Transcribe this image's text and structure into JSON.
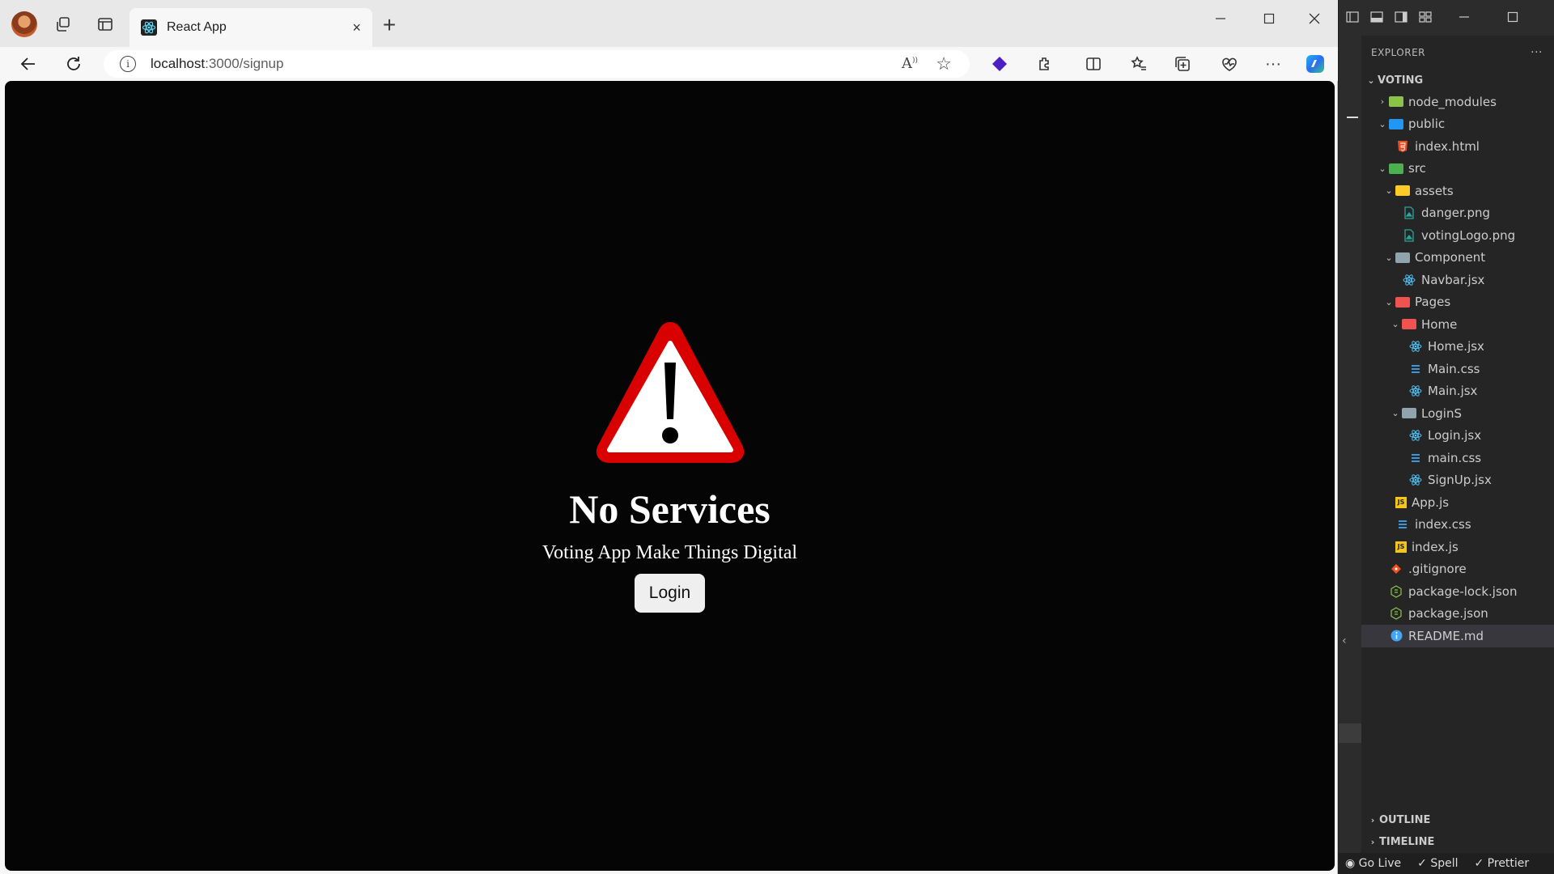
{
  "browser": {
    "tab_title": "React App",
    "new_tab_label": "+",
    "close_tab_label": "×",
    "url_host": "localhost",
    "url_path": ":3000/signup"
  },
  "page": {
    "heading": "No Services",
    "tagline": "Voting App Make Things Digital",
    "login_label": "Login",
    "colors": {
      "background": "#050505",
      "warning_red": "#d90000",
      "text": "#ffffff"
    }
  },
  "vscode": {
    "explorer_title": "EXPLORER",
    "more_label": "···",
    "root": "VOTING",
    "tree": [
      {
        "label": "node_modules",
        "kind": "folder-node",
        "chevron": "›"
      },
      {
        "label": "public",
        "kind": "folder-public",
        "chevron": "⌄"
      },
      {
        "label": "index.html",
        "kind": "html"
      },
      {
        "label": "src",
        "kind": "folder-src",
        "chevron": "⌄"
      },
      {
        "label": "assets",
        "kind": "folder-assets",
        "chevron": "⌄"
      },
      {
        "label": "danger.png",
        "kind": "image"
      },
      {
        "label": "votingLogo.png",
        "kind": "image"
      },
      {
        "label": "Component",
        "kind": "folder-plain",
        "chevron": "⌄"
      },
      {
        "label": "Navbar.jsx",
        "kind": "react"
      },
      {
        "label": "Pages",
        "kind": "folder-red",
        "chevron": "⌄"
      },
      {
        "label": "Home",
        "kind": "folder-red",
        "chevron": "⌄"
      },
      {
        "label": "Home.jsx",
        "kind": "react"
      },
      {
        "label": "Main.css",
        "kind": "css"
      },
      {
        "label": "Main.jsx",
        "kind": "react"
      },
      {
        "label": "LoginS",
        "kind": "folder-plain",
        "chevron": "⌄"
      },
      {
        "label": "Login.jsx",
        "kind": "react"
      },
      {
        "label": "main.css",
        "kind": "css"
      },
      {
        "label": "SignUp.jsx",
        "kind": "react"
      },
      {
        "label": "App.js",
        "kind": "js"
      },
      {
        "label": "index.css",
        "kind": "css"
      },
      {
        "label": "index.js",
        "kind": "js"
      },
      {
        "label": ".gitignore",
        "kind": "git"
      },
      {
        "label": "package-lock.json",
        "kind": "npm"
      },
      {
        "label": "package.json",
        "kind": "npm"
      },
      {
        "label": "README.md",
        "kind": "info"
      }
    ],
    "outline_label": "OUTLINE",
    "timeline_label": "TIMELINE",
    "status": {
      "golive": "Go Live",
      "spell": "Spell",
      "prettier": "Prettier"
    }
  }
}
